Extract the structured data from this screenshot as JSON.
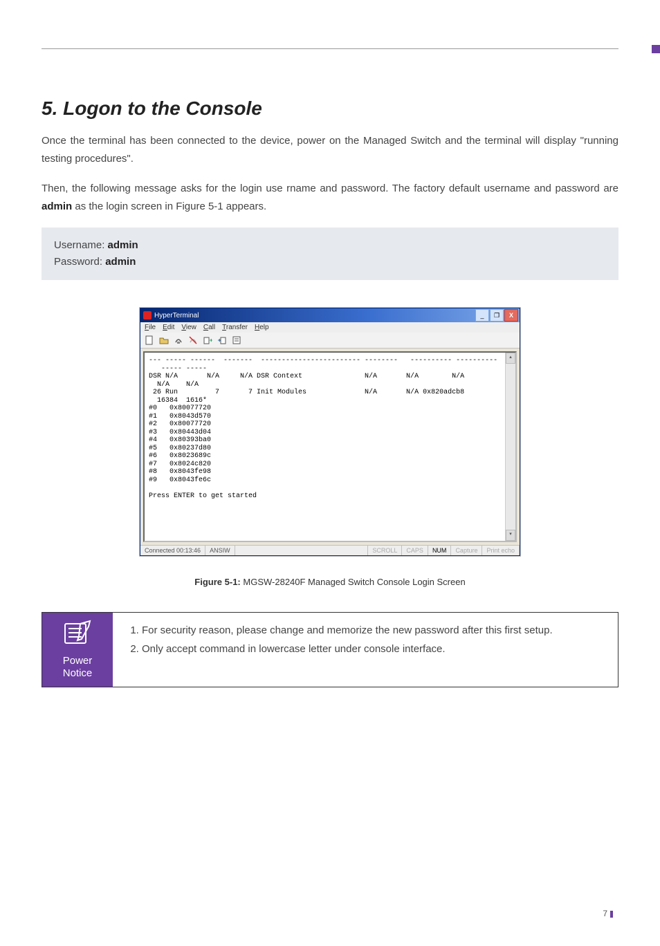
{
  "section": {
    "title": "5. Logon to the Console",
    "para1": "Once the terminal has been connected to the device, power on the Managed Switch and the terminal will display \"running testing procedures\".",
    "para2_pre": "Then, the following message asks for the login use rname and password. The factory default username and password are ",
    "para2_bold": "admin",
    "para2_post": " as the login screen in Figure 5-1 appears."
  },
  "credentials": {
    "username_label": "Username: ",
    "username_value": "admin",
    "password_label": "Password: ",
    "password_value": "admin"
  },
  "hyperterminal": {
    "title": "HyperTerminal",
    "menu": {
      "file": "File",
      "edit": "Edit",
      "view": "View",
      "call": "Call",
      "transfer": "Transfer",
      "help": "Help"
    },
    "terminal_text": "--- ----- ------  -------  ------------------------ --------   ---------- ----------\n   ----- -----\nDSR N/A       N/A     N/A DSR Context               N/A       N/A        N/A\n  N/A    N/A\n 26 Run         7       7 Init Modules              N/A       N/A 0x820adcb8\n  16384  1616*\n#0   0x80077720\n#1   0x8043d570\n#2   0x80077720\n#3   0x80443d04\n#4   0x80393ba0\n#5   0x80237d80\n#6   0x8023689c\n#7   0x8024c820\n#8   0x8043fe98\n#9   0x8043fe6c\n\nPress ENTER to get started",
    "status": {
      "connected": "Connected 00:13:46",
      "emulation": "ANSIW",
      "scroll": "SCROLL",
      "caps": "CAPS",
      "num": "NUM",
      "capture": "Capture",
      "printecho": "Print echo"
    }
  },
  "figure": {
    "label": "Figure 5-1:",
    "text": "  MGSW-28240F Managed Switch Console Login Screen"
  },
  "notice": {
    "label_line1": "Power",
    "label_line2": "Notice",
    "item1": "For security reason, please change and memorize the new password after this first setup.",
    "item2": "Only accept command in lowercase letter under console interface."
  },
  "page_number": "7"
}
